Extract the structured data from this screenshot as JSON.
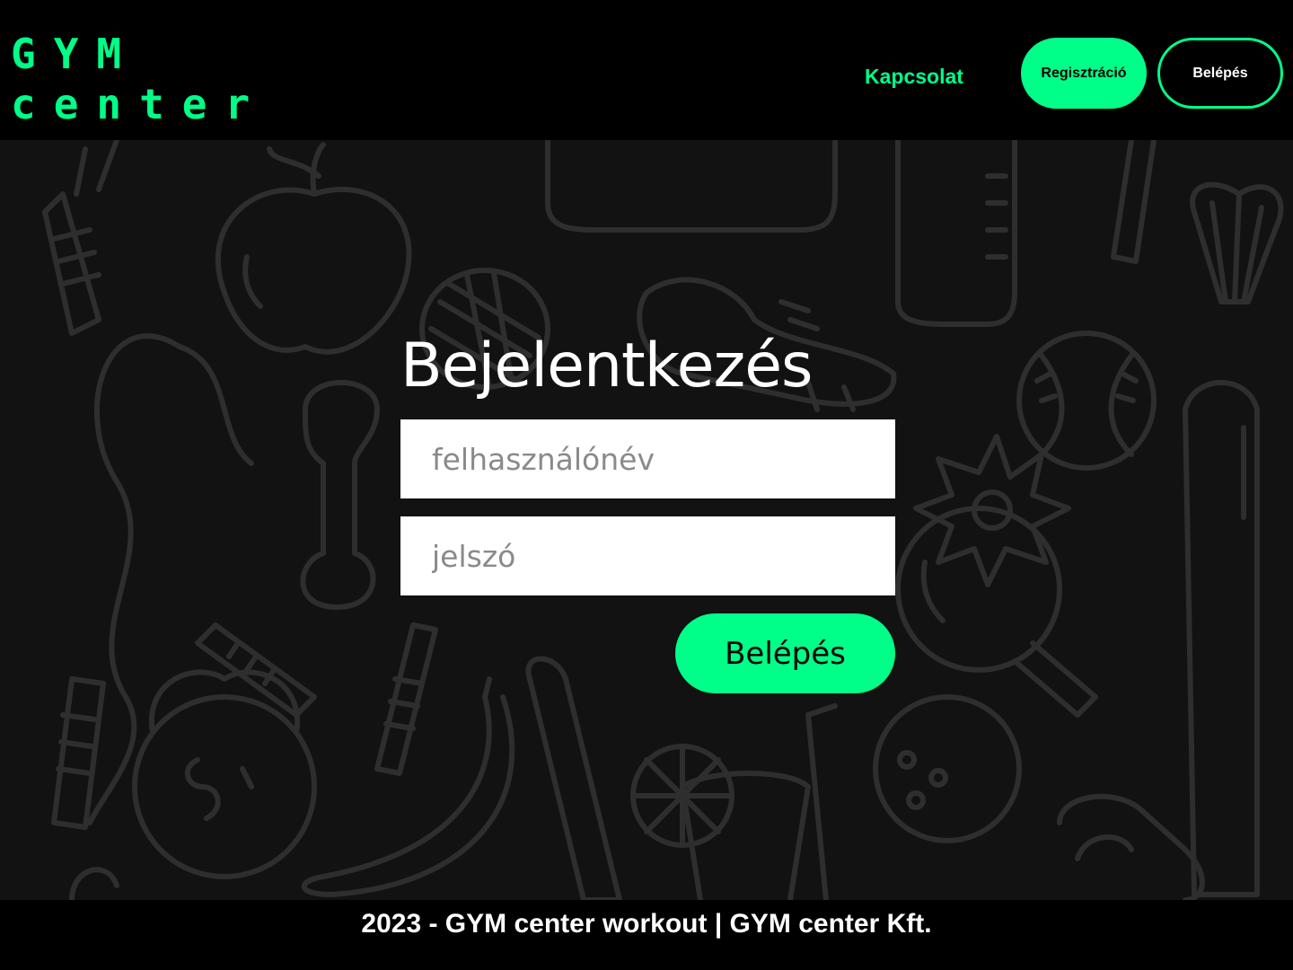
{
  "header": {
    "logo_line1": "GYM",
    "logo_line2": "center",
    "nav_contact": "Kapcsolat",
    "register_button": "Regisztráció",
    "login_button": "Belépés"
  },
  "login": {
    "title": "Bejelentkezés",
    "username_placeholder": "felhasználónév",
    "password_placeholder": "jelszó",
    "submit_button": "Belépés"
  },
  "footer": {
    "text": "2023 - GYM center workout | GYM center Kft."
  },
  "colors": {
    "accent": "#00ff88",
    "header_bg": "#000000",
    "main_bg": "#121212",
    "doodle_stroke": "#2e2e2e"
  },
  "icons": {
    "background": "fitness-doodle-pattern"
  }
}
